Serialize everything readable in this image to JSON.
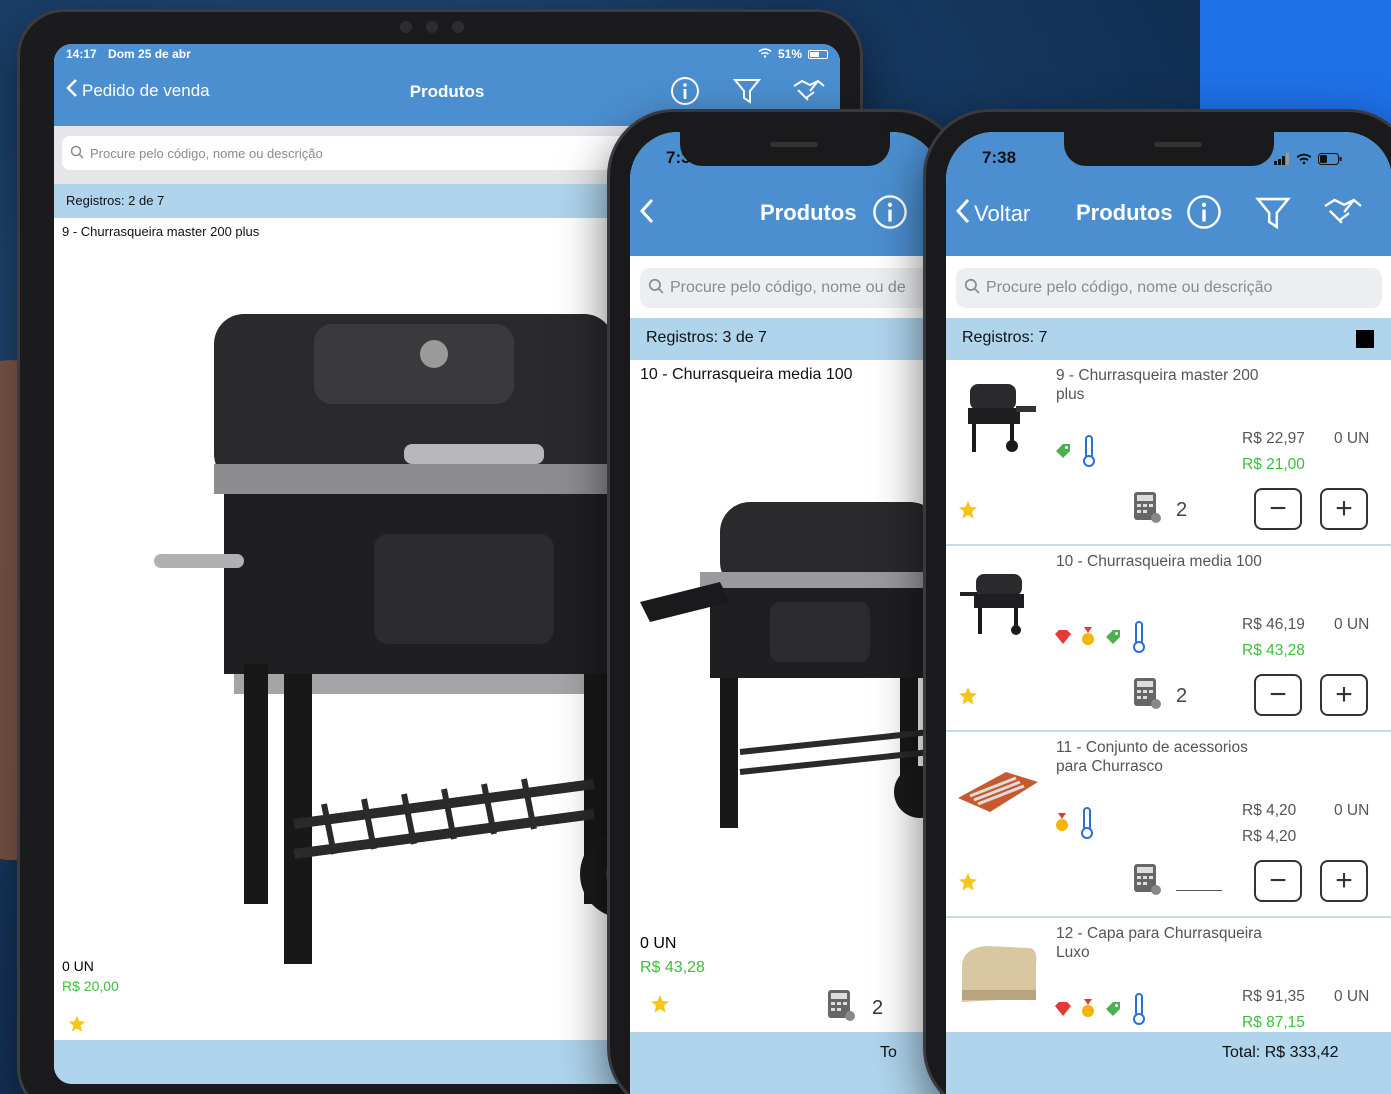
{
  "colors": {
    "accent": "#4b8fd0",
    "header_bar": "#afd4ec",
    "price_green": "#3cbf3c"
  },
  "ipad": {
    "status": {
      "time": "14:17",
      "date": "Dom 25 de abr",
      "battery": "51%"
    },
    "nav": {
      "back_label": "Pedido de venda",
      "title": "Produtos"
    },
    "search_placeholder": "Procure pelo código, nome ou descrição",
    "records": "Registros: 2 de 7",
    "product_title": "9 - Churrasqueira master 200 plus",
    "stock": "0 UN",
    "price": "R$ 20,00"
  },
  "phone_middle": {
    "time": "7:39",
    "title": "Produtos",
    "search_placeholder": "Procure pelo código, nome ou de",
    "records": "Registros: 3 de 7",
    "product_title": "10 - Churrasqueira media 100",
    "stock": "0 UN",
    "price": "R$ 43,28",
    "quantity": "2",
    "total_partial": "To"
  },
  "phone_right": {
    "time": "7:38",
    "back_label": "Voltar",
    "title": "Produtos",
    "search_placeholder": "Procure pelo código, nome ou descrição",
    "records": "Registros: 7",
    "items": [
      {
        "name": "9 - Churrasqueira master 200 plus",
        "price_old": "R$ 22,97",
        "price_new": "R$ 21,00",
        "stock": "0 UN",
        "quantity": "2"
      },
      {
        "name": "10 - Churrasqueira media 100",
        "price_old": "R$ 46,19",
        "price_new": "R$ 43,28",
        "stock": "0 UN",
        "quantity": "2"
      },
      {
        "name": "11 - Conjunto de acessorios para Churrasco",
        "price_old": "R$ 4,20",
        "price_new": "R$ 4,20",
        "stock": "0 UN",
        "quantity": ""
      },
      {
        "name": "12 - Capa para Churrasqueira Luxo",
        "price_old": "R$ 91,35",
        "price_new": "R$ 87,15",
        "stock": "0 UN",
        "quantity": ""
      }
    ],
    "total": "Total: R$ 333,42",
    "minus_label": "−",
    "plus_label": "+"
  }
}
